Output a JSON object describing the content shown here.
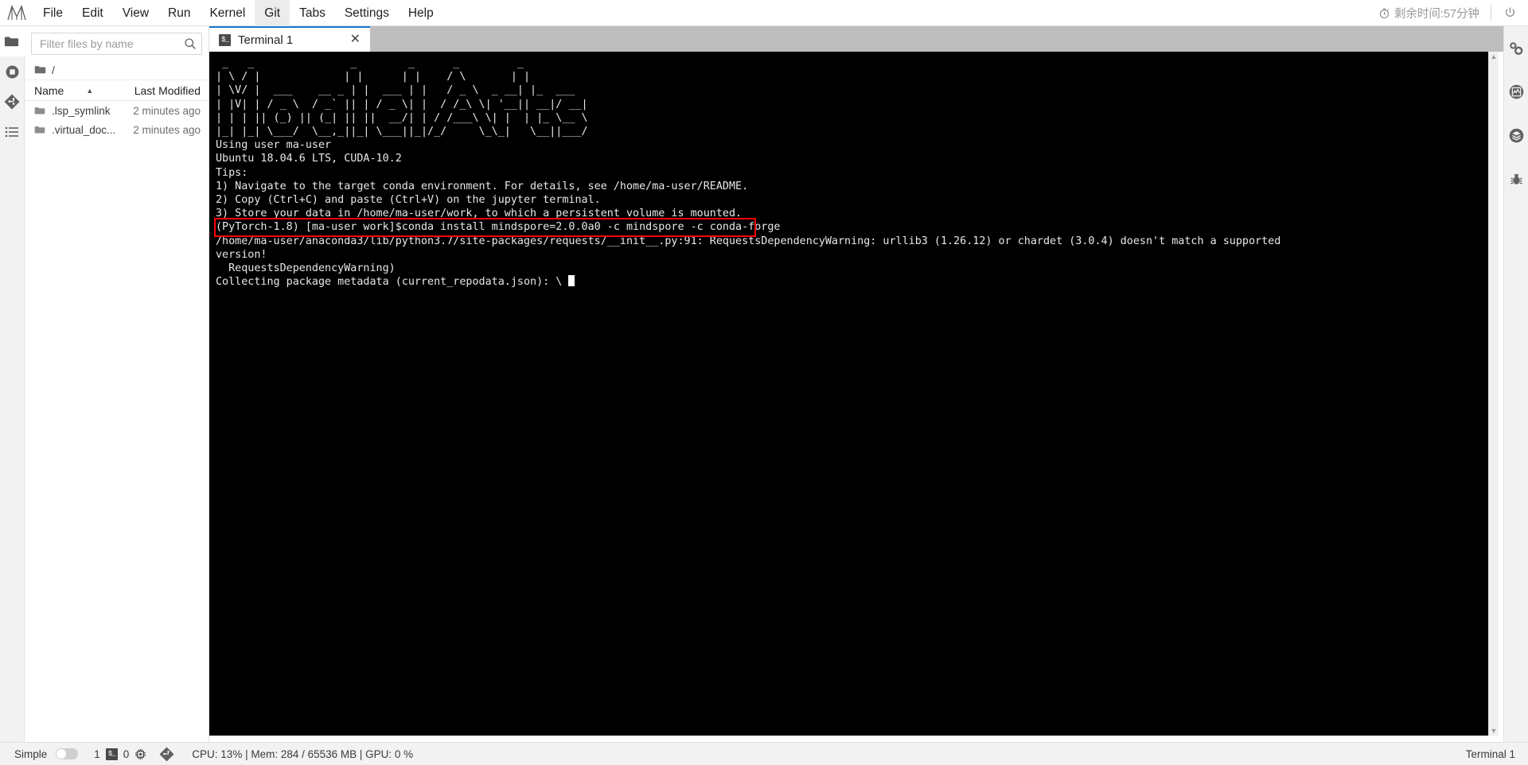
{
  "menubar": {
    "logo_name": "jupyterlab-logo",
    "items": [
      {
        "label": "File",
        "name": "menu-file"
      },
      {
        "label": "Edit",
        "name": "menu-edit"
      },
      {
        "label": "View",
        "name": "menu-view"
      },
      {
        "label": "Run",
        "name": "menu-run"
      },
      {
        "label": "Kernel",
        "name": "menu-kernel"
      },
      {
        "label": "Git",
        "name": "menu-git"
      },
      {
        "label": "Tabs",
        "name": "menu-tabs"
      },
      {
        "label": "Settings",
        "name": "menu-settings"
      },
      {
        "label": "Help",
        "name": "menu-help"
      }
    ],
    "timer_text": "剩余时间:57分钟",
    "timer_icon": "stopwatch-icon",
    "power_icon": "power-icon"
  },
  "left_rail": {
    "items": [
      {
        "name": "sidebar-item-file-browser",
        "icon": "folder-icon",
        "active": true
      },
      {
        "name": "sidebar-item-running",
        "icon": "stop-circle-icon",
        "active": false
      },
      {
        "name": "sidebar-item-git",
        "icon": "git-diamond-icon",
        "active": false
      },
      {
        "name": "sidebar-item-commands",
        "icon": "list-icon",
        "active": false
      }
    ]
  },
  "right_rail": {
    "items": [
      {
        "name": "sidebar-item-property-inspector",
        "icon": "gears-icon"
      },
      {
        "name": "sidebar-item-chart",
        "icon": "chart-circle-icon"
      },
      {
        "name": "sidebar-item-extensions",
        "icon": "layers-icon"
      },
      {
        "name": "sidebar-item-debugger",
        "icon": "bug-icon"
      }
    ]
  },
  "filebrowser": {
    "toolbar": {
      "folder_icon": "folder-icon",
      "new_launcher_label": "+",
      "new_folder_icon": "new-folder-icon",
      "upload_icon": "upload-icon",
      "refresh_icon": "refresh-icon",
      "git_clone_icon": "git-clone-icon"
    },
    "filter": {
      "placeholder": "Filter files by name",
      "value": "",
      "search_icon": "search-icon"
    },
    "breadcrumb": {
      "root_icon": "folder-icon",
      "path": "/"
    },
    "columns": {
      "name": "Name",
      "last_modified": "Last Modified",
      "sort_caret": "▲"
    },
    "rows": [
      {
        "name": ".lsp_symlink",
        "modified": "2 minutes ago",
        "icon": "folder-icon"
      },
      {
        "name": ".virtual_doc...",
        "modified": "2 minutes ago",
        "icon": "folder-icon"
      }
    ]
  },
  "tabbar": {
    "tabs": [
      {
        "label": "Terminal 1",
        "icon": "terminal-icon",
        "close_icon": "close-icon",
        "close_label": "✕",
        "active": true
      }
    ]
  },
  "terminal": {
    "banner": [
      "  __  __             _        _      _         _       ",
      " |  \\/  |           | |      | |    / \\       | |      ",
      " | \\  / | ___   __| | ___| |    / _ \\  _ __| |_ ___ ",
      " | |\\/| |/ _ \\ / _` |/ _ \\ |   / /_\\ \\| '__| __/ __|",
      " | |  | | (_) | (_| |  __/ |  /  ___  \\ |  | |_\\__ \\",
      " |_|  |_|\\___/ \\__,_|\\___|_| /_/   \\_\\_|   \\__|___/"
    ],
    "lines": [
      "Using user ma-user",
      "Ubuntu 18.04.6 LTS, CUDA-10.2",
      "Tips:",
      "1) Navigate to the target conda environment. For details, see /home/ma-user/README.",
      "2) Copy (Ctrl+C) and paste (Ctrl+V) on the jupyter terminal.",
      "3) Store your data in /home/ma-user/work, to which a persistent volume is mounted."
    ],
    "command_line": "(PyTorch-1.8) [ma-user work]$conda install mindspore=2.0.0a0 -c mindspore -c conda-forge",
    "output_lines": [
      "/home/ma-user/anaconda3/lib/python3.7/site-packages/requests/__init__.py:91: RequestsDependencyWarning: urllib3 (1.26.12) or chardet (3.0.4) doesn't match a supported",
      "version!",
      "  RequestsDependencyWarning)",
      "Collecting package metadata (current_repodata.json): \\ "
    ],
    "highlight_color": "#ff0000",
    "scrollbar": {
      "up_icon": "caret-up-icon",
      "down_icon": "caret-down-icon"
    }
  },
  "statusbar": {
    "simple_label": "Simple",
    "toggle_on": false,
    "kernel_count": "1",
    "terminal_icon": "terminal-icon",
    "terminal_count": "0",
    "cpu_icon": "cpu-icon",
    "git_icon": "git-diamond-icon",
    "metrics": "CPU: 13% | Mem: 284 / 65536 MB | GPU: 0 %",
    "right_label": "Terminal 1"
  }
}
